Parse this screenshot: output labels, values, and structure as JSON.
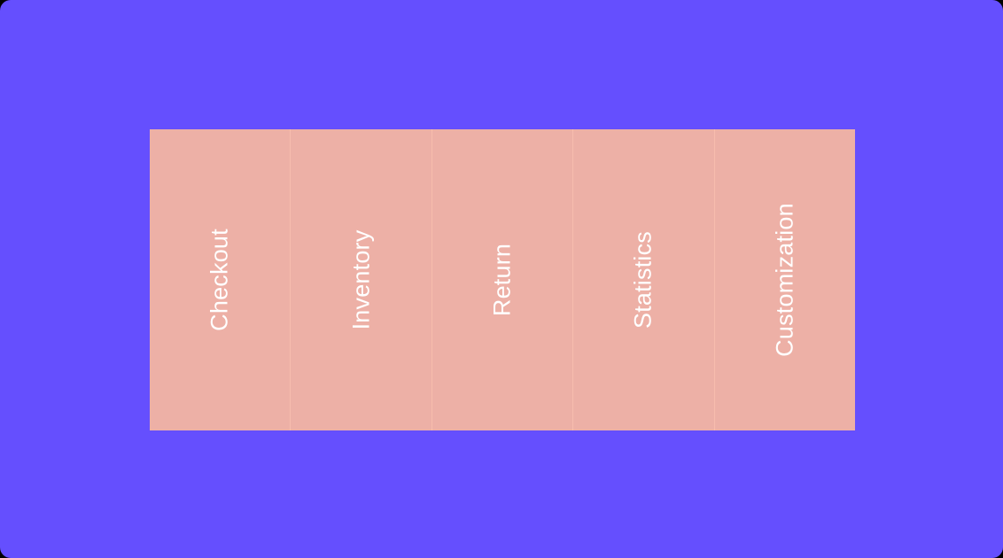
{
  "colors": {
    "background": "#654ffe",
    "panel": "#edb0a6",
    "text": "#ffffff"
  },
  "menu": {
    "items": [
      {
        "label": "Checkout"
      },
      {
        "label": "Inventory"
      },
      {
        "label": "Return"
      },
      {
        "label": "Statistics"
      },
      {
        "label": "Customization"
      }
    ]
  }
}
